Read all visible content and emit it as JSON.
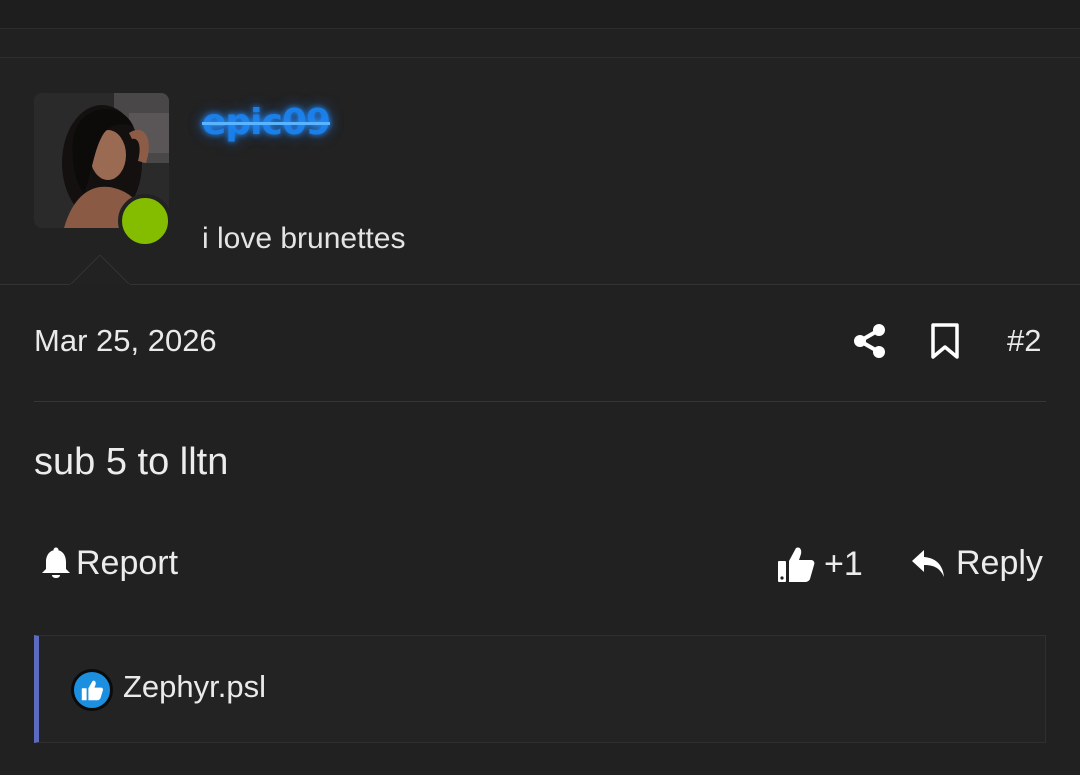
{
  "post": {
    "author": {
      "username": "epic09",
      "title": "i love brunettes",
      "status_color": "#84bd00",
      "username_color": "#1a7fe8"
    },
    "date": "Mar 25, 2026",
    "number": "#2",
    "body": "sub 5 to lltn",
    "icons": {
      "share": "share-icon",
      "bookmark": "bookmark-icon",
      "report": "bell-icon",
      "like": "thumbs-up-icon",
      "reply": "reply-arrow-icon"
    },
    "actions": {
      "report_label": "Report",
      "reaction_count": "+1",
      "reply_label": "Reply"
    },
    "reactions": {
      "accent_color": "#5c6bc0",
      "badge_color": "#1d8fe0",
      "users": [
        "Zephyr.psl"
      ]
    }
  }
}
